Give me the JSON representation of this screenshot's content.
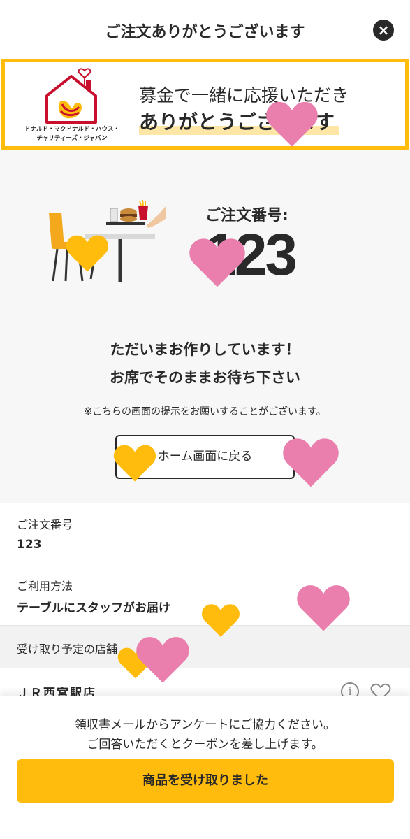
{
  "header": {
    "title": "ご注文ありがとうございます",
    "close_label": "×"
  },
  "banner": {
    "org_name_line1": "ドナルド・マクドナルド・ハウス・",
    "org_name_line2": "チャリティーズ・ジャパン",
    "line1": "募金で一緒に応援いただき",
    "line2": "ありがとうございます"
  },
  "status": {
    "order_label": "ご注文番号:",
    "order_number": "123",
    "message_line1": "ただいまお作りしています！",
    "message_line2": "お席でそのままお待ち下さい",
    "note": "※こちらの画面の提示をお願いすることがございます。",
    "home_button": "ホーム画面に戻る"
  },
  "details": {
    "order_number_label": "ご注文番号",
    "order_number_value": "123",
    "usage_label": "ご利用方法",
    "usage_value": "テーブルにスタッフがお届け",
    "store_label": "受け取り予定の店舗",
    "store_name": "ＪＲ西宮駅店"
  },
  "bottom": {
    "survey_line1": "領収書メールからアンケートにご協力ください。",
    "survey_line2": "ご回答いただくとクーポンを差し上げます。",
    "receive_button": "商品を受け取りました"
  },
  "colors": {
    "accent_yellow": "#ffbc0d",
    "heart_pink": "#ea7fae",
    "heart_yellow": "#ffbc0d",
    "text_dark": "#292929"
  },
  "icons": {
    "close": "close-icon",
    "info": "info-icon",
    "favorite": "heart-outline-icon"
  }
}
